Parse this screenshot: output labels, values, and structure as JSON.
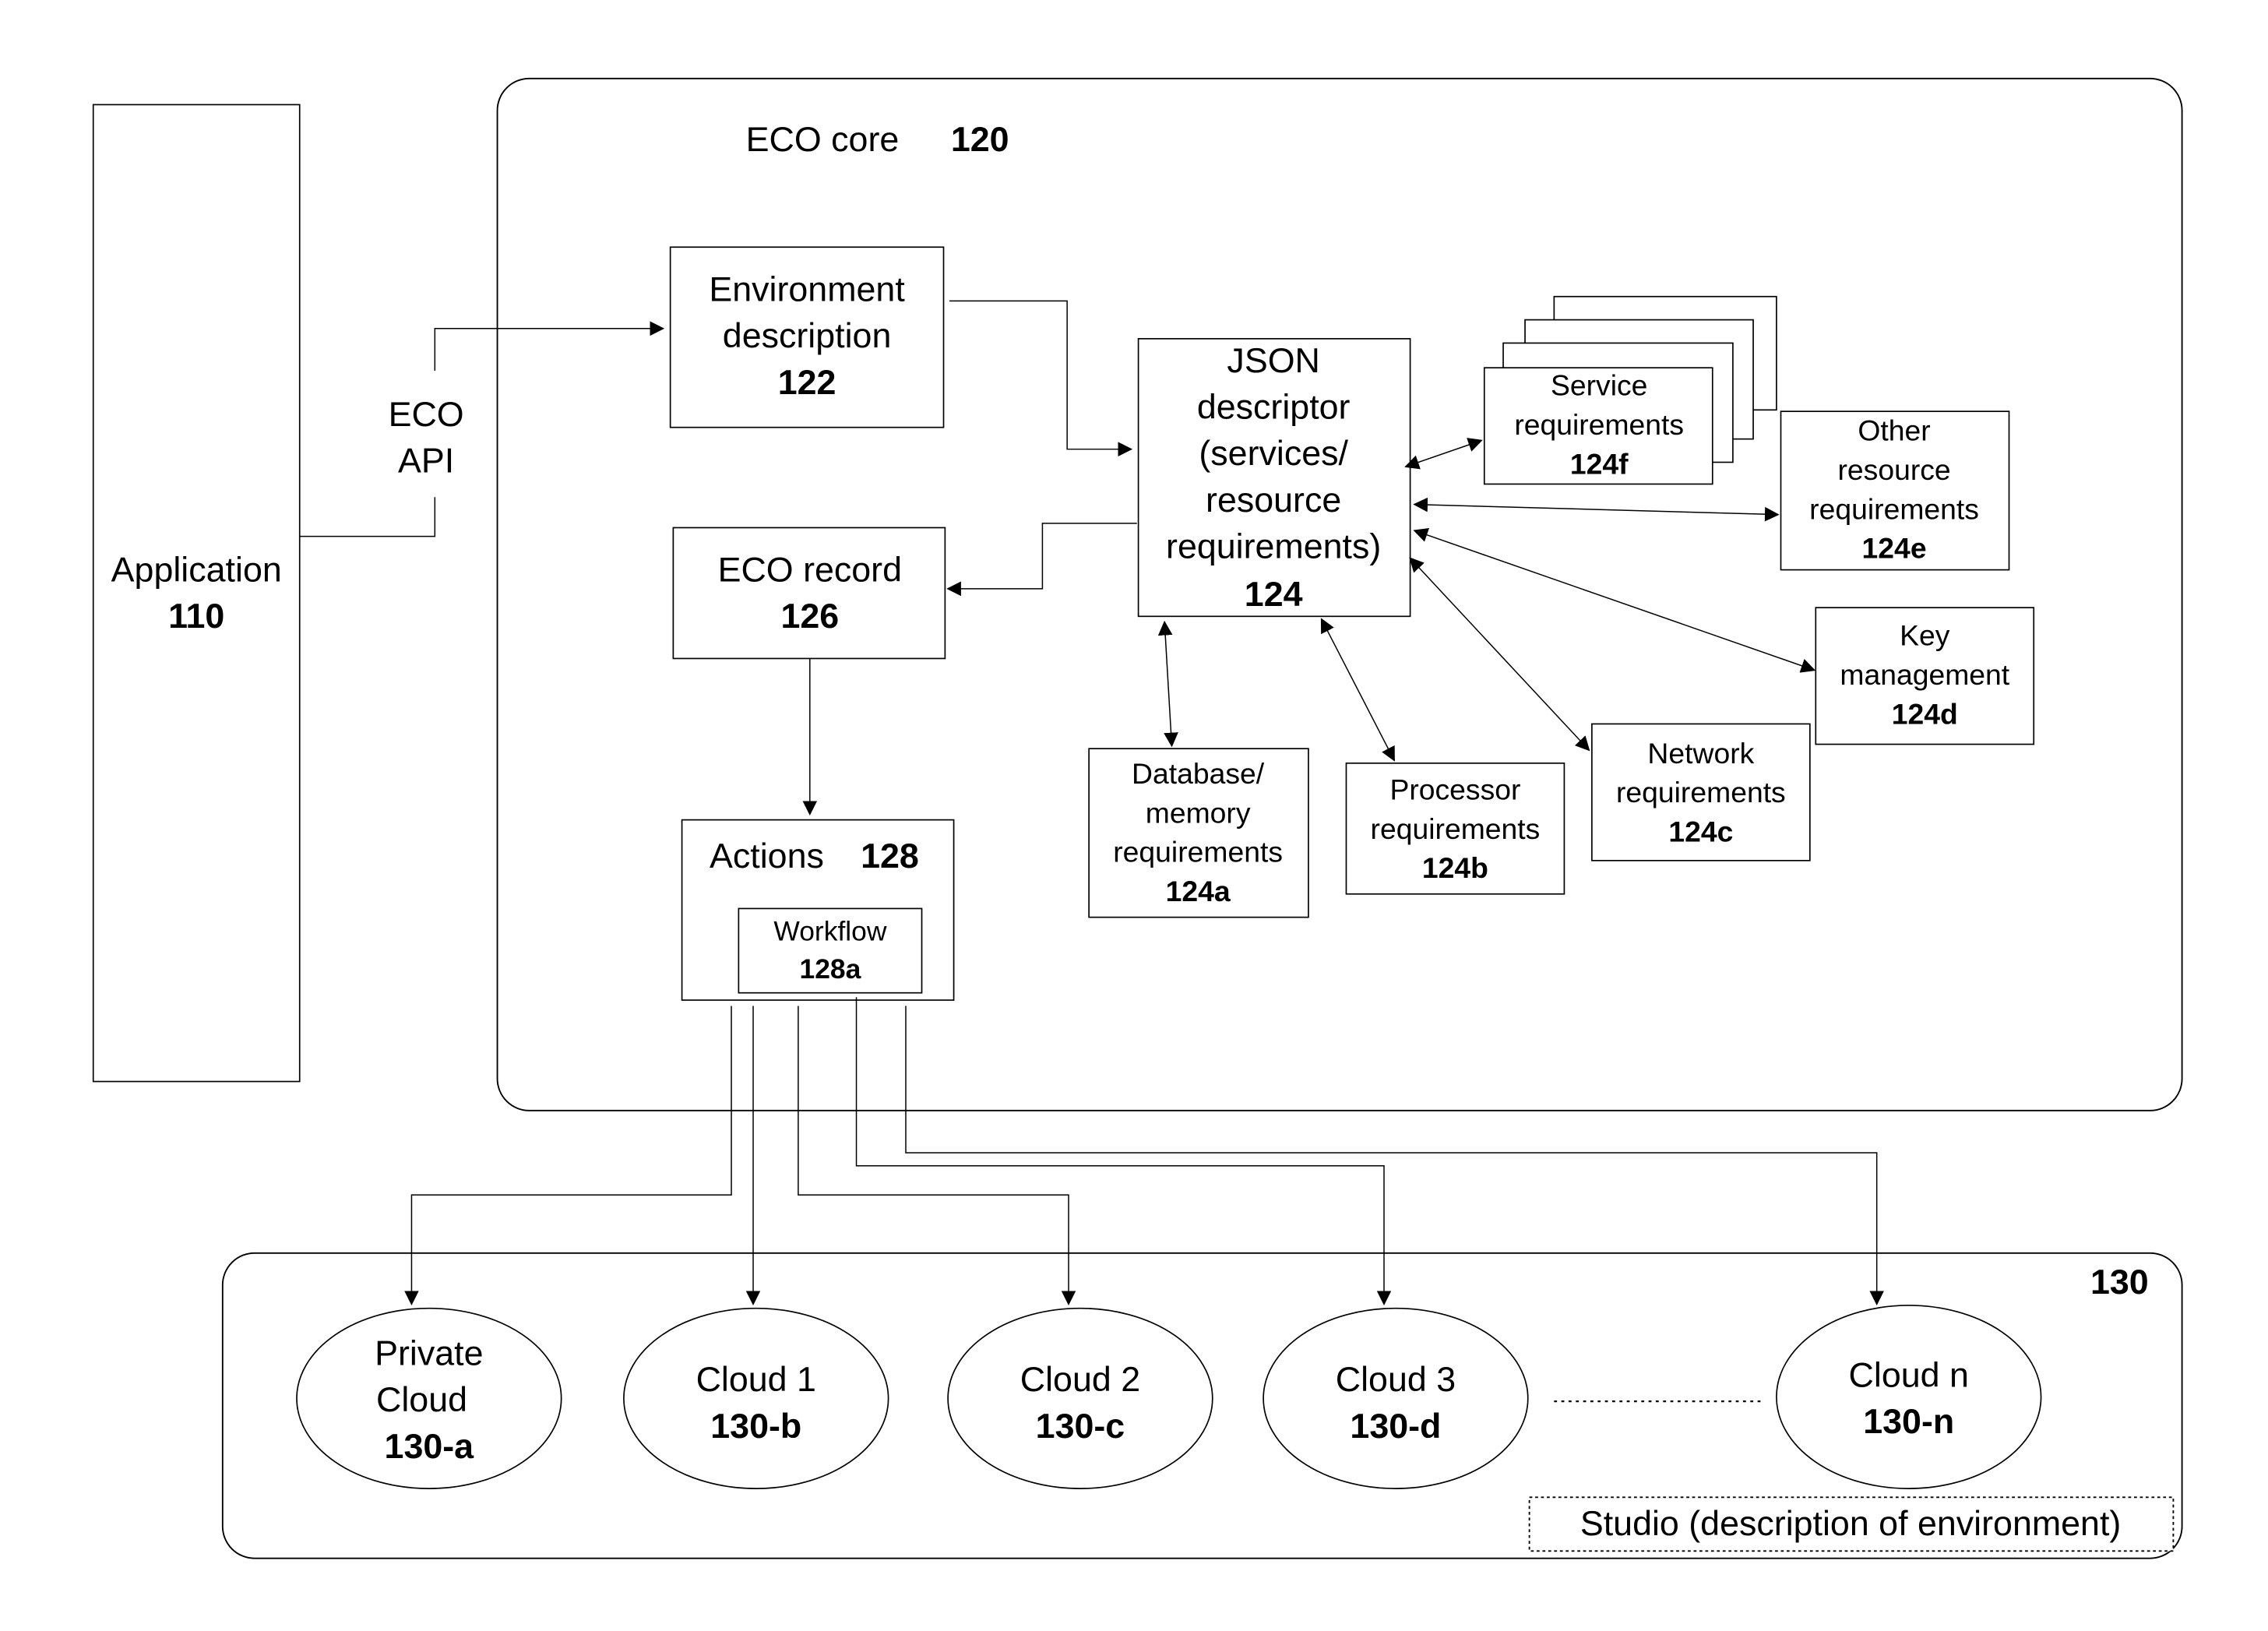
{
  "diagram": {
    "application": {
      "label": "Application",
      "ref": "110"
    },
    "eco_api": {
      "line1": "ECO",
      "line2": "API"
    },
    "eco_core": {
      "label": "ECO core",
      "ref": "120"
    },
    "environment_description": {
      "line1": "Environment",
      "line2": "description",
      "ref": "122"
    },
    "eco_record": {
      "label": "ECO record",
      "ref": "126"
    },
    "actions": {
      "label": "Actions",
      "ref": "128"
    },
    "workflow": {
      "label": "Workflow",
      "ref": "128a"
    },
    "json_descriptor": {
      "lines": [
        "JSON",
        "descriptor",
        "(services/",
        "resource",
        "requirements)"
      ],
      "ref": "124"
    },
    "service_requirements": {
      "line1": "Service",
      "line2": "requirements",
      "ref": "124f"
    },
    "other_resource_requirements": {
      "line1": "Other",
      "line2": "resource",
      "line3": "requirements",
      "ref": "124e"
    },
    "key_management": {
      "line1": "Key",
      "line2": "management",
      "ref": "124d"
    },
    "network_requirements": {
      "line1": "Network",
      "line2": "requirements",
      "ref": "124c"
    },
    "processor_requirements": {
      "line1": "Processor",
      "line2": "requirements",
      "ref": "124b"
    },
    "database_memory_requirements": {
      "line1": "Database/",
      "line2": "memory",
      "line3": "requirements",
      "ref": "124a"
    },
    "clouds_container": {
      "ref": "130"
    },
    "clouds": [
      {
        "line1": "Private",
        "line2": "Cloud",
        "ref": "130-a"
      },
      {
        "line1": "Cloud 1",
        "ref": "130-b"
      },
      {
        "line1": "Cloud 2",
        "ref": "130-c"
      },
      {
        "line1": "Cloud 3",
        "ref": "130-d"
      },
      {
        "line1": "Cloud n",
        "ref": "130-n"
      }
    ],
    "studio": {
      "label": "Studio (description of environment)"
    }
  }
}
